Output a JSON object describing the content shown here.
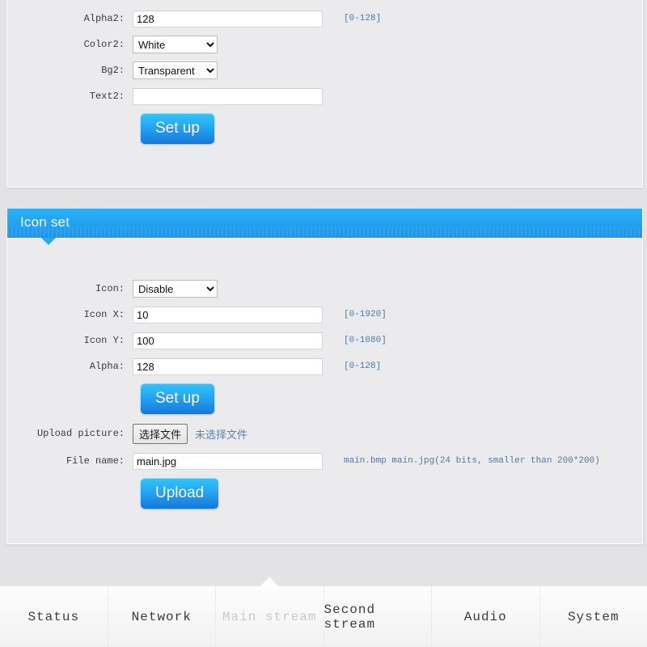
{
  "osd_panel": {
    "rows": [
      {
        "label": "Alpha2:",
        "type": "text",
        "value": "128",
        "hint": "[0-128]"
      },
      {
        "label": "Color2:",
        "type": "select",
        "value": "White",
        "hint": ""
      },
      {
        "label": "Bg2:",
        "type": "select",
        "value": "Transparent",
        "hint": ""
      },
      {
        "label": "Text2:",
        "type": "text",
        "value": "",
        "hint": ""
      }
    ],
    "setup_label": "Set up"
  },
  "icon_panel": {
    "header_title": "Icon set",
    "rows": [
      {
        "label": "Icon:",
        "type": "select",
        "value": "Disable",
        "hint": ""
      },
      {
        "label": "Icon X:",
        "type": "text",
        "value": "10",
        "hint": "[0-1920]"
      },
      {
        "label": "Icon Y:",
        "type": "text",
        "value": "100",
        "hint": "[0-1080]"
      },
      {
        "label": "Alpha:",
        "type": "text",
        "value": "128",
        "hint": "[0-128]"
      }
    ],
    "setup_label": "Set up",
    "upload_picture": {
      "label": "Upload picture:",
      "choose_button": "选择文件",
      "status": "未选择文件"
    },
    "file_name": {
      "label": "File name:",
      "value": "main.jpg",
      "hint": "main.bmp main.jpg(24 bits, smaller than 200*200)"
    },
    "upload_label": "Upload"
  },
  "tabs": [
    {
      "label": "Status",
      "active": false
    },
    {
      "label": "Network",
      "active": false
    },
    {
      "label": "Main stream",
      "active": true
    },
    {
      "label": "Second stream",
      "active": false
    },
    {
      "label": "Audio",
      "active": false
    },
    {
      "label": "System",
      "active": false
    }
  ],
  "colors": {
    "accent_blue": "#22a4f0",
    "button_blue": "#1577dd",
    "hint_text": "#4a79ab",
    "page_bg": "#e3e3e5",
    "panel_bg": "#ebebed"
  }
}
